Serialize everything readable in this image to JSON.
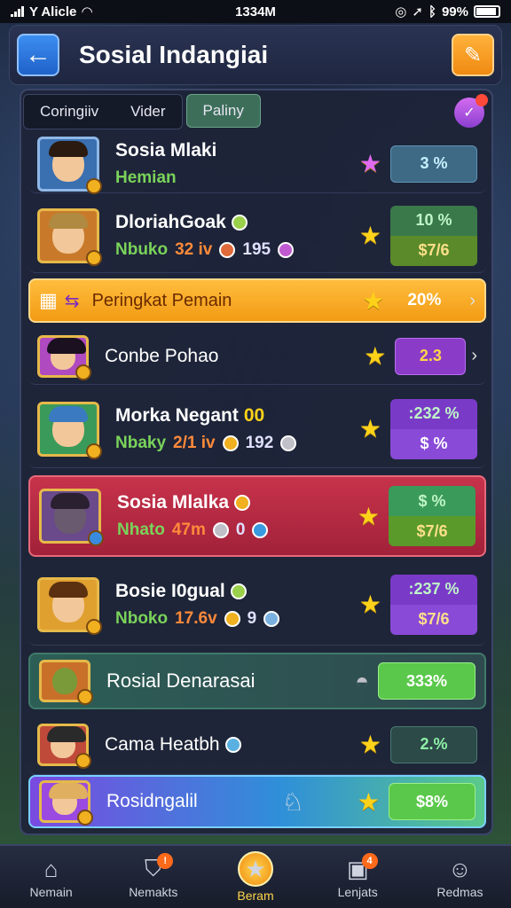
{
  "status": {
    "carrier": "Y Alicle",
    "time": "1334M",
    "battery": "99%"
  },
  "header": {
    "title": "Sosial Indangiai"
  },
  "tabs": [
    {
      "label": "Coringiiv"
    },
    {
      "label": "Vider"
    },
    {
      "label": "Paliny"
    }
  ],
  "players": [
    {
      "name": "Sosia Mlaki",
      "sub": "Hemian",
      "stat": "3 %"
    },
    {
      "name": "DloriahGoak",
      "sub_a": "Nbuko",
      "sub_lvl": "32 iv",
      "sub_num": "195",
      "stat_top": "10 %",
      "stat_bottom": "$7/6"
    },
    {
      "name": "Peringkat Pemain",
      "stat": "20%"
    },
    {
      "name": "Conbe Pohao",
      "stat": "2.3"
    },
    {
      "name": "Morka Negant",
      "badge": "00",
      "sub_a": "Nbaky",
      "sub_lvl": "2/1 iv",
      "sub_num": "192",
      "stat_top": ":232 %",
      "stat_bottom": "$ %"
    },
    {
      "name": "Sosia Mlalka",
      "sub_a": "Nhato",
      "sub_lvl": "47m",
      "sub_num": "0",
      "stat_top": "$ %",
      "stat_bottom": "$7/6"
    },
    {
      "name": "Bosie I0gual",
      "sub_a": "Nboko",
      "sub_lvl": "17.6v",
      "sub_num": "9",
      "stat_top": ":237 %",
      "stat_bottom": "$7/6"
    },
    {
      "name": "Rosial Denarasai",
      "stat": "333%"
    },
    {
      "name": "Cama Heatbh",
      "stat": "2.%"
    },
    {
      "name": "Rosidngalil",
      "stat": "$8%"
    }
  ],
  "nav": [
    {
      "label": "Nemain"
    },
    {
      "label": "Nemakts"
    },
    {
      "label": "Beram"
    },
    {
      "label": "Lenjats"
    },
    {
      "label": "Redmas"
    }
  ],
  "colors": {
    "accent_orange": "#f29b14",
    "accent_green": "#3d6e5a",
    "highlight_red": "#c7334b",
    "purple": "#8a3cc8"
  }
}
